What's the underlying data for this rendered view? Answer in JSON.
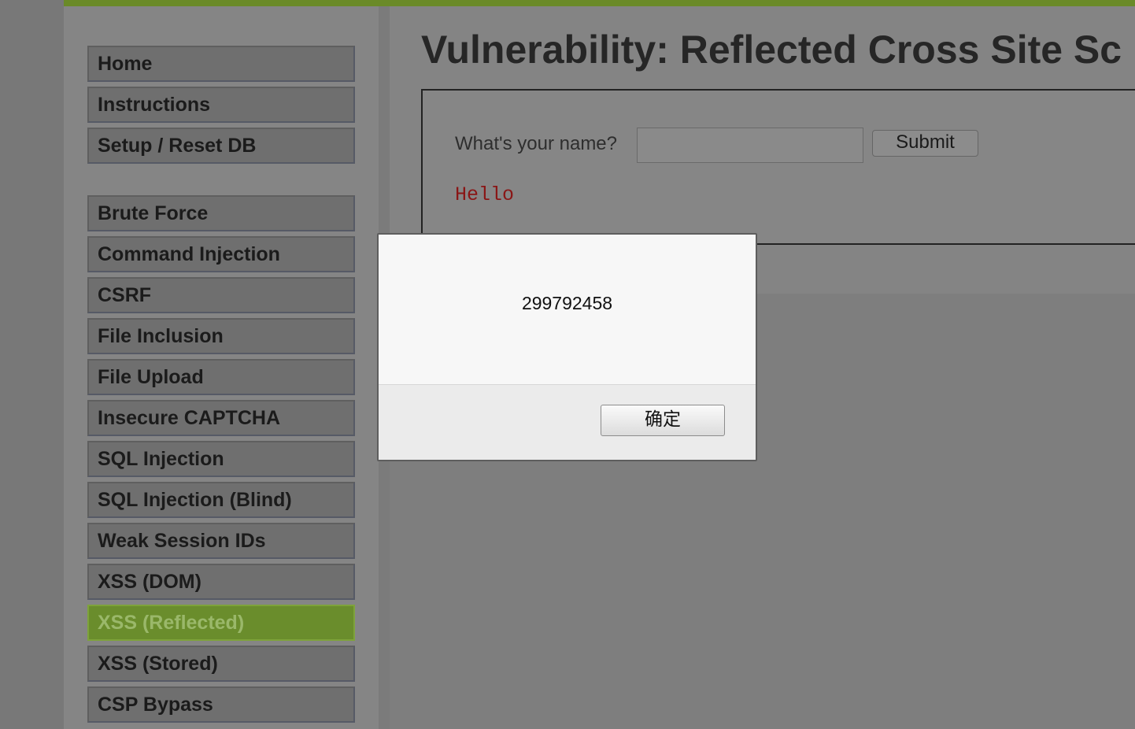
{
  "page": {
    "title": "Vulnerability: Reflected Cross Site Sc"
  },
  "sidebar": {
    "items": [
      {
        "label": "Home"
      },
      {
        "label": "Instructions"
      },
      {
        "label": "Setup / Reset DB"
      },
      {
        "label": "Brute Force"
      },
      {
        "label": "Command Injection"
      },
      {
        "label": "CSRF"
      },
      {
        "label": "File Inclusion"
      },
      {
        "label": "File Upload"
      },
      {
        "label": "Insecure CAPTCHA"
      },
      {
        "label": "SQL Injection"
      },
      {
        "label": "SQL Injection (Blind)"
      },
      {
        "label": "Weak Session IDs"
      },
      {
        "label": "XSS (DOM)"
      },
      {
        "label": "XSS (Reflected)",
        "active": true
      },
      {
        "label": "XSS (Stored)"
      },
      {
        "label": "CSP Bypass"
      }
    ]
  },
  "form": {
    "question": "What's your name?",
    "input_value": "",
    "submit_label": "Submit"
  },
  "output": {
    "hello": "Hello"
  },
  "alert": {
    "message": "299792458",
    "ok_label": "确定"
  },
  "colors": {
    "accent_green": "#6a8d2c",
    "hello_red": "#8a1616"
  }
}
